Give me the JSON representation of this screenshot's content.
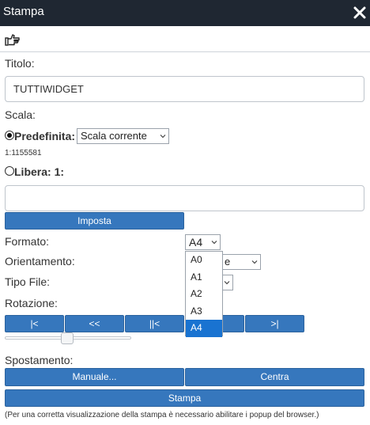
{
  "dialog": {
    "title": "Stampa",
    "close_icon": "close-x-icon",
    "tool_icon": "hand-pointer-icon"
  },
  "labels": {
    "titolo": "Titolo:",
    "scala": "Scala:",
    "predefinita": "Predefinita:",
    "scale_value": "1:1155581",
    "libera": "Libera: 1:",
    "formato": "Formato:",
    "orientamento": "Orientamento:",
    "tipo_file": "Tipo File:",
    "rotazione": "Rotazione:",
    "spostamento": "Spostamento:",
    "footnote": "(Per una corretta visualizzazione della stampa è necessario abilitare i popup del browser.)"
  },
  "fields": {
    "titolo_value": "TUTTIWIDGET",
    "libera_value": "",
    "scala_select": "Scala corrente",
    "formato_select": "A4",
    "orientamento_partial": "e"
  },
  "scale_mode": "predefinita",
  "formato_options": [
    "A0",
    "A1",
    "A2",
    "A3",
    "A4"
  ],
  "formato_selected": "A4",
  "buttons": {
    "imposta": "Imposta",
    "rot_first": "|<",
    "rot_prev_fast": "<<",
    "rot_prev": "||<",
    "rot_last": ">|",
    "manuale": "Manuale...",
    "centra": "Centra",
    "stampa": "Stampa"
  },
  "rotation_slider_fraction": 0.5,
  "colors": {
    "titlebar": "#1f2732",
    "button": "#3677bd",
    "dropdown_selected": "#1973d1"
  }
}
